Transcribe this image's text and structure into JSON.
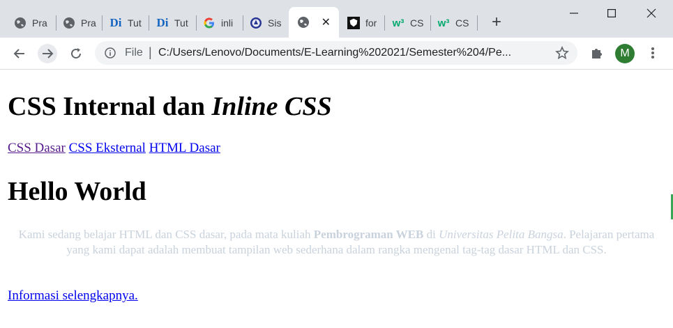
{
  "browser": {
    "tabs": [
      {
        "title": "Pra",
        "icon": "globe-icon"
      },
      {
        "title": "Pra",
        "icon": "globe-icon"
      },
      {
        "title": "Tut",
        "icon": "di-logo-icon",
        "icon_text": "Di"
      },
      {
        "title": "Tut",
        "icon": "di-logo-icon",
        "icon_text": "Di"
      },
      {
        "title": "inli",
        "icon": "google-logo-icon"
      },
      {
        "title": "Sis",
        "icon": "university-seal-icon"
      },
      {
        "title": "",
        "icon": "globe-icon",
        "active": true,
        "close": "✕"
      },
      {
        "title": "for",
        "icon": "shield-box-icon"
      },
      {
        "title": "CS",
        "icon": "w3schools-icon",
        "icon_text": "w³"
      },
      {
        "title": "CS",
        "icon": "w3schools-icon",
        "icon_text": "w³"
      }
    ],
    "new_tab": "+",
    "window": {
      "minimize": "—",
      "maximize": "☐",
      "close": "✕"
    },
    "omnibox": {
      "scheme_label": "File",
      "url": "C:/Users/Lenovo/Documents/E-Learning%202021/Semester%204/Pe..."
    },
    "profile_initial": "M",
    "colors": {
      "tabstrip": "#dee1e6",
      "accent": "#2e7d32"
    }
  },
  "page": {
    "heading_plain": "CSS Internal dan ",
    "heading_italic": "Inline CSS",
    "nav_links": [
      "CSS Dasar",
      "CSS Eksternal",
      "HTML Dasar"
    ],
    "hello": "Hello World",
    "para_1": "Kami sedang belajar HTML dan CSS dasar, pada mata kuliah ",
    "para_bold": "Pembrograman WEB",
    "para_2": " di ",
    "para_italic": "Universitas Pelita Bangsa",
    "para_3": ". Pelajaran pertama yang kami dapat adalah membuat tampilan web sederhana dalam rangka mengenal tag-tag dasar HTML dan CSS.",
    "more_link": "Informasi selengkapnya."
  }
}
